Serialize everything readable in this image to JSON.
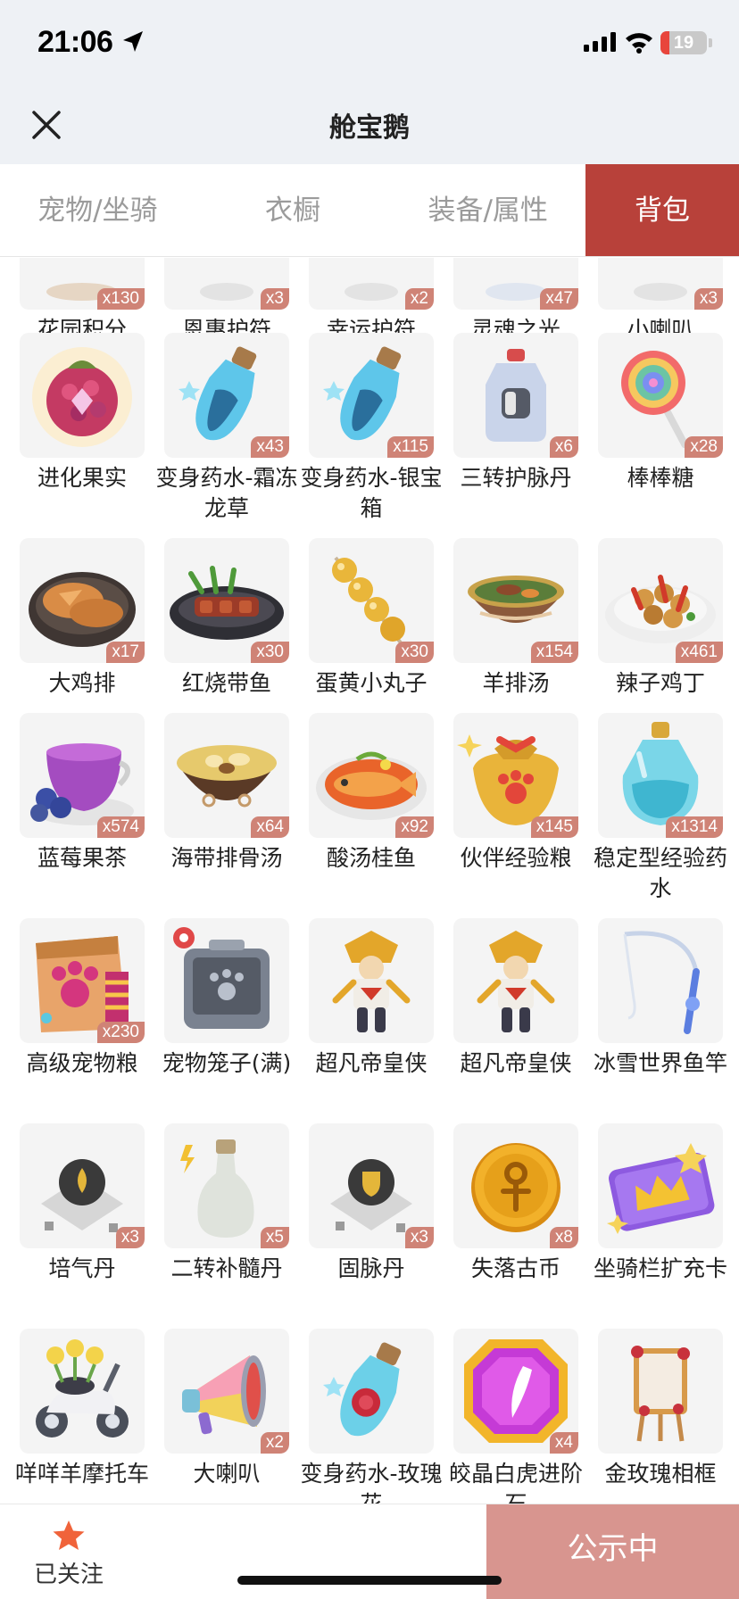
{
  "status": {
    "time": "21:06",
    "battery": "19",
    "battery_level": 0.19
  },
  "nav": {
    "title": "舱宝鹅"
  },
  "tabs": [
    {
      "label": "宠物/坐骑",
      "active": false
    },
    {
      "label": "衣橱",
      "active": false
    },
    {
      "label": "装备/属性",
      "active": false
    },
    {
      "label": "背包",
      "active": true
    }
  ],
  "items": [
    {
      "name": "花园积分",
      "count": "x130",
      "icon": "garden-points-icon"
    },
    {
      "name": "恩惠护符",
      "count": "x3",
      "icon": "grace-amulet-icon"
    },
    {
      "name": "幸运护符",
      "count": "x2",
      "icon": "luck-amulet-icon"
    },
    {
      "name": "灵魂之光",
      "count": "x47",
      "icon": "soul-light-icon"
    },
    {
      "name": "小喇叭",
      "count": "x3",
      "icon": "small-horn-icon"
    },
    {
      "name": "进化果实",
      "count": "",
      "icon": "evolution-fruit-icon"
    },
    {
      "name": "变身药水-霜冻龙草",
      "count": "x43",
      "icon": "potion-blue-icon"
    },
    {
      "name": "变身药水-银宝箱",
      "count": "x115",
      "icon": "potion-blue-icon"
    },
    {
      "name": "三转护脉丹",
      "count": "x6",
      "icon": "pill-bottle-icon"
    },
    {
      "name": "棒棒糖",
      "count": "x28",
      "icon": "lollipop-icon"
    },
    {
      "name": "大鸡排",
      "count": "x17",
      "icon": "chicken-cutlet-icon"
    },
    {
      "name": "红烧带鱼",
      "count": "x30",
      "icon": "braised-fish-icon"
    },
    {
      "name": "蛋黄小丸子",
      "count": "x30",
      "icon": "yolk-balls-icon"
    },
    {
      "name": "羊排汤",
      "count": "x154",
      "icon": "lamb-soup-icon"
    },
    {
      "name": "辣子鸡丁",
      "count": "x461",
      "icon": "spicy-chicken-icon"
    },
    {
      "name": "蓝莓果茶",
      "count": "x574",
      "icon": "blueberry-tea-icon"
    },
    {
      "name": "海带排骨汤",
      "count": "x64",
      "icon": "kelp-soup-icon"
    },
    {
      "name": "酸汤桂鱼",
      "count": "x92",
      "icon": "sour-fish-icon"
    },
    {
      "name": "伙伴经验粮",
      "count": "x145",
      "icon": "food-bag-icon"
    },
    {
      "name": "稳定型经验药水",
      "count": "x1314",
      "icon": "exp-potion-icon"
    },
    {
      "name": "高级宠物粮",
      "count": "x230",
      "icon": "pet-food-icon"
    },
    {
      "name": "宠物笼子(满)",
      "count": "",
      "icon": "pet-cage-icon"
    },
    {
      "name": "超凡帝皇侠",
      "count": "",
      "icon": "hero-figure-icon"
    },
    {
      "name": "超凡帝皇侠",
      "count": "",
      "icon": "hero-figure-icon"
    },
    {
      "name": "冰雪世界鱼竿",
      "count": "",
      "icon": "fishing-rod-icon"
    },
    {
      "name": "培气丹",
      "count": "x3",
      "icon": "pill-drop-icon"
    },
    {
      "name": "二转补髓丹",
      "count": "x5",
      "icon": "bottle-icon"
    },
    {
      "name": "固脉丹",
      "count": "x3",
      "icon": "pill-shield-icon"
    },
    {
      "name": "失落古币",
      "count": "x8",
      "icon": "ancient-coin-icon"
    },
    {
      "name": "坐骑栏扩充卡",
      "count": "",
      "icon": "mount-card-icon"
    },
    {
      "name": "咩咩羊摩托车",
      "count": "",
      "icon": "motorbike-icon"
    },
    {
      "name": "大喇叭",
      "count": "x2",
      "icon": "megaphone-icon"
    },
    {
      "name": "变身药水-玫瑰花",
      "count": "",
      "icon": "potion-rose-icon"
    },
    {
      "name": "皎晶白虎进阶石",
      "count": "x4",
      "icon": "gem-stone-icon"
    },
    {
      "name": "金玫瑰相框",
      "count": "",
      "icon": "easel-frame-icon"
    }
  ],
  "bottom": {
    "follow_label": "已关注",
    "publicity_label": "公示中"
  },
  "colors": {
    "accent": "#b8413a",
    "badge": "#cf8376",
    "publicity": "#d8958f",
    "star": "#f0633a"
  }
}
